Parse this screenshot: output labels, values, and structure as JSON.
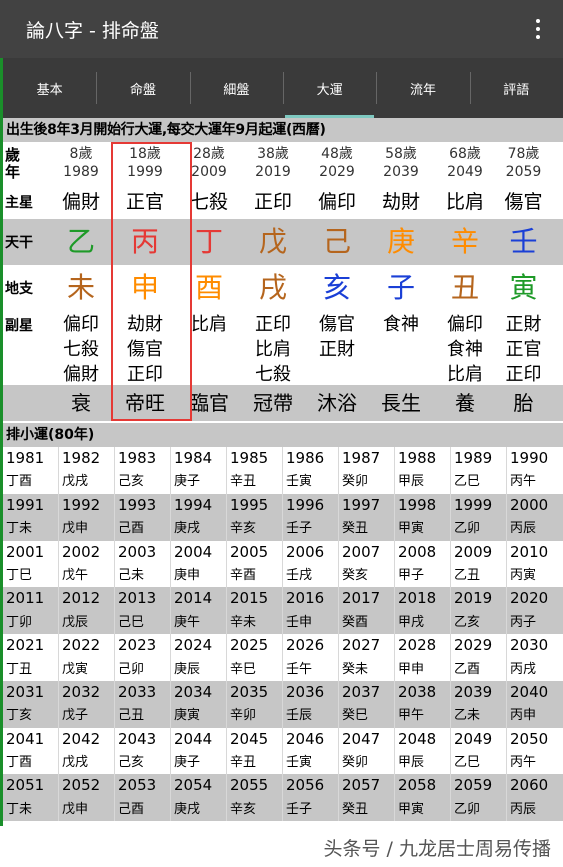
{
  "app": {
    "title": "論八字 - 排命盤"
  },
  "tabs": [
    {
      "label": "基本"
    },
    {
      "label": "命盤"
    },
    {
      "label": "細盤"
    },
    {
      "label": "大運",
      "active": true
    },
    {
      "label": "流年"
    },
    {
      "label": "評語"
    }
  ],
  "notice": "出生後8年3月開始行大運,每交大運年9月起運(西曆)",
  "labels": {
    "age_top": "歲",
    "age_bottom": "年",
    "main_star": "主星",
    "stem": "天干",
    "branch": "地支",
    "hidden": "副星"
  },
  "pillars": [
    {
      "age": "8歲",
      "year": "1989",
      "main": "偏財",
      "stem": "乙",
      "stem_color": "#1e9a28",
      "branch": "未",
      "branch_color": "#b5651d",
      "hidden": [
        "偏印",
        "七殺",
        "偏財"
      ],
      "stage": "衰"
    },
    {
      "age": "18歲",
      "year": "1999",
      "main": "正官",
      "stem": "丙",
      "stem_color": "#e53935",
      "branch": "申",
      "branch_color": "#ff8c00",
      "hidden": [
        "劫財",
        "傷官",
        "正印"
      ],
      "stage": "帝旺"
    },
    {
      "age": "28歲",
      "year": "2009",
      "main": "七殺",
      "stem": "丁",
      "stem_color": "#e53935",
      "branch": "酉",
      "branch_color": "#ff8c00",
      "hidden": [
        "比肩"
      ],
      "stage": "臨官"
    },
    {
      "age": "38歲",
      "year": "2019",
      "main": "正印",
      "stem": "戊",
      "stem_color": "#b5651d",
      "branch": "戌",
      "branch_color": "#b5651d",
      "hidden": [
        "正印",
        "比肩",
        "七殺"
      ],
      "stage": "冠帶"
    },
    {
      "age": "48歲",
      "year": "2029",
      "main": "偏印",
      "stem": "己",
      "stem_color": "#b5651d",
      "branch": "亥",
      "branch_color": "#1a3fd6",
      "hidden": [
        "傷官",
        "正財"
      ],
      "stage": "沐浴"
    },
    {
      "age": "58歲",
      "year": "2039",
      "main": "劫財",
      "stem": "庚",
      "stem_color": "#ff8c00",
      "branch": "子",
      "branch_color": "#1a3fd6",
      "hidden": [
        "食神"
      ],
      "stage": "長生"
    },
    {
      "age": "68歲",
      "year": "2049",
      "main": "比肩",
      "stem": "辛",
      "stem_color": "#ff8c00",
      "branch": "丑",
      "branch_color": "#b5651d",
      "hidden": [
        "偏印",
        "食神",
        "比肩"
      ],
      "stage": "養"
    },
    {
      "age": "78歲",
      "year": "2059",
      "main": "傷官",
      "stem": "壬",
      "stem_color": "#1a3fd6",
      "branch": "寅",
      "branch_color": "#1e9a28",
      "hidden": [
        "正財",
        "正官",
        "正印"
      ],
      "stage": "胎"
    }
  ],
  "mini_luck": {
    "title": "排小運(80年)",
    "rows": [
      {
        "years": [
          "1981",
          "1982",
          "1983",
          "1984",
          "1985",
          "1986",
          "1987",
          "1988",
          "1989",
          "1990"
        ],
        "gz": [
          "丁酉",
          "戊戌",
          "己亥",
          "庚子",
          "辛丑",
          "壬寅",
          "癸卯",
          "甲辰",
          "乙巳",
          "丙午"
        ]
      },
      {
        "years": [
          "1991",
          "1992",
          "1993",
          "1994",
          "1995",
          "1996",
          "1997",
          "1998",
          "1999",
          "2000"
        ],
        "gz": [
          "丁未",
          "戊申",
          "己酉",
          "庚戌",
          "辛亥",
          "壬子",
          "癸丑",
          "甲寅",
          "乙卯",
          "丙辰"
        ]
      },
      {
        "years": [
          "2001",
          "2002",
          "2003",
          "2004",
          "2005",
          "2006",
          "2007",
          "2008",
          "2009",
          "2010"
        ],
        "gz": [
          "丁巳",
          "戊午",
          "己未",
          "庚申",
          "辛酉",
          "壬戌",
          "癸亥",
          "甲子",
          "乙丑",
          "丙寅"
        ]
      },
      {
        "years": [
          "2011",
          "2012",
          "2013",
          "2014",
          "2015",
          "2016",
          "2017",
          "2018",
          "2019",
          "2020"
        ],
        "gz": [
          "丁卯",
          "戊辰",
          "己巳",
          "庚午",
          "辛未",
          "壬申",
          "癸酉",
          "甲戌",
          "乙亥",
          "丙子"
        ]
      },
      {
        "years": [
          "2021",
          "2022",
          "2023",
          "2024",
          "2025",
          "2026",
          "2027",
          "2028",
          "2029",
          "2030"
        ],
        "gz": [
          "丁丑",
          "戊寅",
          "己卯",
          "庚辰",
          "辛巳",
          "壬午",
          "癸未",
          "甲申",
          "乙酉",
          "丙戌"
        ]
      },
      {
        "years": [
          "2031",
          "2032",
          "2033",
          "2034",
          "2035",
          "2036",
          "2037",
          "2038",
          "2039",
          "2040"
        ],
        "gz": [
          "丁亥",
          "戊子",
          "己丑",
          "庚寅",
          "辛卯",
          "壬辰",
          "癸巳",
          "甲午",
          "乙未",
          "丙申"
        ]
      },
      {
        "years": [
          "2041",
          "2042",
          "2043",
          "2044",
          "2045",
          "2046",
          "2047",
          "2048",
          "2049",
          "2050"
        ],
        "gz": [
          "丁酉",
          "戊戌",
          "己亥",
          "庚子",
          "辛丑",
          "壬寅",
          "癸卯",
          "甲辰",
          "乙巳",
          "丙午"
        ]
      },
      {
        "years": [
          "2051",
          "2052",
          "2053",
          "2054",
          "2055",
          "2056",
          "2057",
          "2058",
          "2059",
          "2060"
        ],
        "gz": [
          "丁未",
          "戊申",
          "己酉",
          "庚戌",
          "辛亥",
          "壬子",
          "癸丑",
          "甲寅",
          "乙卯",
          "丙辰"
        ]
      }
    ]
  },
  "watermark": "头条号 / 九龙居士周易传播"
}
